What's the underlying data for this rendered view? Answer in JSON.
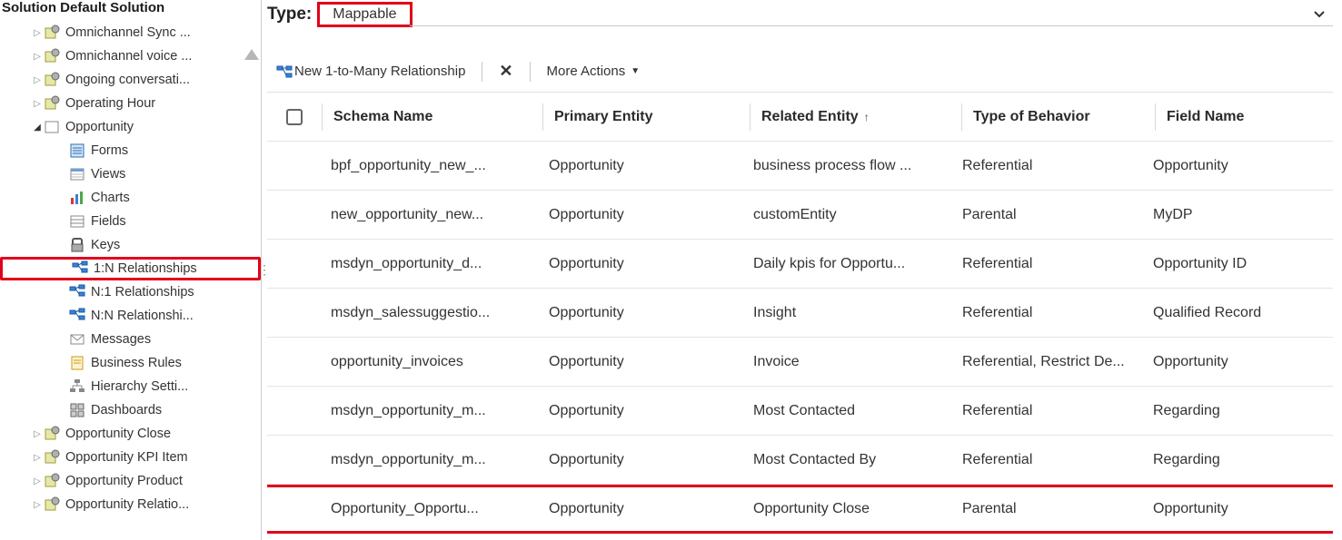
{
  "sidebar": {
    "title": "Solution Default Solution",
    "nodes": [
      {
        "indent": 2,
        "expander": "▷",
        "icon": "entity-sync-icon",
        "label": "Omnichannel Sync ..."
      },
      {
        "indent": 2,
        "expander": "▷",
        "icon": "entity-voice-icon",
        "label": "Omnichannel voice ..."
      },
      {
        "indent": 2,
        "expander": "▷",
        "icon": "entity-convo-icon",
        "label": "Ongoing conversati..."
      },
      {
        "indent": 2,
        "expander": "▷",
        "icon": "entity-hour-icon",
        "label": "Operating Hour"
      },
      {
        "indent": 2,
        "expander": "▲",
        "icon": "entity-opportunity-icon",
        "label": "Opportunity",
        "expanded": true
      },
      {
        "indent": 4,
        "expander": "",
        "icon": "forms-icon",
        "label": "Forms"
      },
      {
        "indent": 4,
        "expander": "",
        "icon": "views-icon",
        "label": "Views"
      },
      {
        "indent": 4,
        "expander": "",
        "icon": "charts-icon",
        "label": "Charts"
      },
      {
        "indent": 4,
        "expander": "",
        "icon": "fields-icon",
        "label": "Fields"
      },
      {
        "indent": 4,
        "expander": "",
        "icon": "keys-icon",
        "label": "Keys"
      },
      {
        "indent": 4,
        "expander": "",
        "icon": "rel-1n-icon",
        "label": "1:N Relationships",
        "highlight": true
      },
      {
        "indent": 4,
        "expander": "",
        "icon": "rel-n1-icon",
        "label": "N:1 Relationships"
      },
      {
        "indent": 4,
        "expander": "",
        "icon": "rel-nn-icon",
        "label": "N:N Relationshi..."
      },
      {
        "indent": 4,
        "expander": "",
        "icon": "messages-icon",
        "label": "Messages"
      },
      {
        "indent": 4,
        "expander": "",
        "icon": "rules-icon",
        "label": "Business Rules"
      },
      {
        "indent": 4,
        "expander": "",
        "icon": "hierarchy-icon",
        "label": "Hierarchy Setti..."
      },
      {
        "indent": 4,
        "expander": "",
        "icon": "dashboards-icon",
        "label": "Dashboards"
      },
      {
        "indent": 2,
        "expander": "▷",
        "icon": "entity-close-icon",
        "label": "Opportunity Close"
      },
      {
        "indent": 2,
        "expander": "▷",
        "icon": "entity-kpi-icon",
        "label": "Opportunity KPI Item"
      },
      {
        "indent": 2,
        "expander": "▷",
        "icon": "entity-product-icon",
        "label": "Opportunity Product"
      },
      {
        "indent": 2,
        "expander": "▷",
        "icon": "entity-relation-icon",
        "label": "Opportunity Relatio..."
      }
    ]
  },
  "typeFilter": {
    "label": "Type:",
    "value": "Mappable"
  },
  "toolbar": {
    "new_rel": "New 1-to-Many Relationship",
    "more": "More Actions"
  },
  "columns": {
    "schema": "Schema Name",
    "primary": "Primary Entity",
    "related": "Related Entity",
    "behavior": "Type of Behavior",
    "field": "Field Name"
  },
  "rows": [
    {
      "schema": "bpf_opportunity_new_...",
      "primary": "Opportunity",
      "related": "business process flow ...",
      "behavior": "Referential",
      "field": "Opportunity"
    },
    {
      "schema": "new_opportunity_new...",
      "primary": "Opportunity",
      "related": "customEntity",
      "behavior": "Parental",
      "field": "MyDP"
    },
    {
      "schema": "msdyn_opportunity_d...",
      "primary": "Opportunity",
      "related": "Daily kpis for Opportu...",
      "behavior": "Referential",
      "field": "Opportunity ID"
    },
    {
      "schema": "msdyn_salessuggestio...",
      "primary": "Opportunity",
      "related": "Insight",
      "behavior": "Referential",
      "field": "Qualified Record"
    },
    {
      "schema": "opportunity_invoices",
      "primary": "Opportunity",
      "related": "Invoice",
      "behavior": "Referential, Restrict De...",
      "field": "Opportunity"
    },
    {
      "schema": "msdyn_opportunity_m...",
      "primary": "Opportunity",
      "related": "Most Contacted",
      "behavior": "Referential",
      "field": "Regarding"
    },
    {
      "schema": "msdyn_opportunity_m...",
      "primary": "Opportunity",
      "related": "Most Contacted By",
      "behavior": "Referential",
      "field": "Regarding"
    },
    {
      "schema": "Opportunity_Opportu...",
      "primary": "Opportunity",
      "related": "Opportunity Close",
      "behavior": "Parental",
      "field": "Opportunity",
      "highlight": true
    }
  ]
}
